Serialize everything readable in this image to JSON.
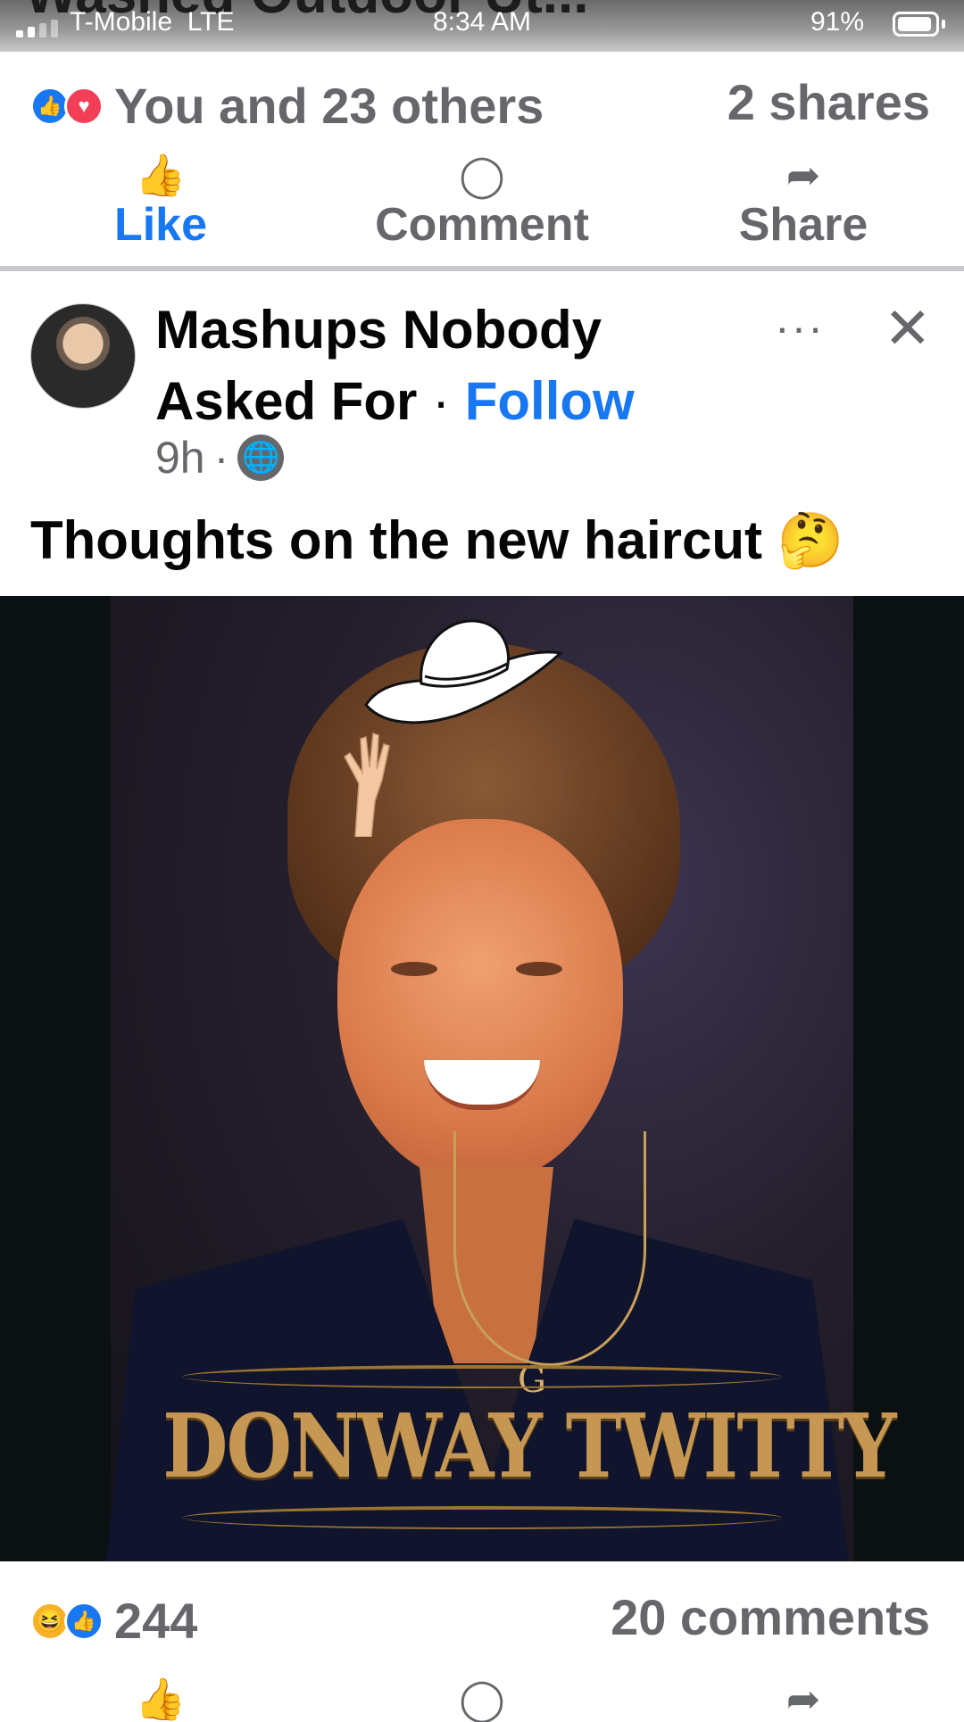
{
  "status_bar": {
    "peek_title": "Washed Outdoor Ut...",
    "carrier": "T-Mobile",
    "network": "LTE",
    "time": "8:34 AM",
    "battery": "91%",
    "battery_level": 0.91
  },
  "prev_post": {
    "reactions_text": "You and 23 others",
    "shares": "2 shares",
    "reaction_icons": [
      "like-icon",
      "love-icon"
    ]
  },
  "actions": {
    "like": "Like",
    "comment": "Comment",
    "share": "Share"
  },
  "post": {
    "author_line1": "Mashups Nobody",
    "author_line2": "Asked For",
    "separator": "·",
    "follow": "Follow",
    "time": "9h",
    "time_sep": "·",
    "more": "···",
    "close": "✕",
    "caption": "Thoughts on the new haircut 🤔",
    "image_title": "DONWAY TWITTY",
    "pendant": "G",
    "reaction_count": "244",
    "comments": "20 comments",
    "reaction_icons": [
      "haha-icon",
      "like-icon"
    ]
  },
  "colors": {
    "accent": "#1877f2",
    "muted": "#65676b",
    "love": "#f33e58",
    "haha": "#f7b125",
    "title_gold": "#c69753"
  }
}
